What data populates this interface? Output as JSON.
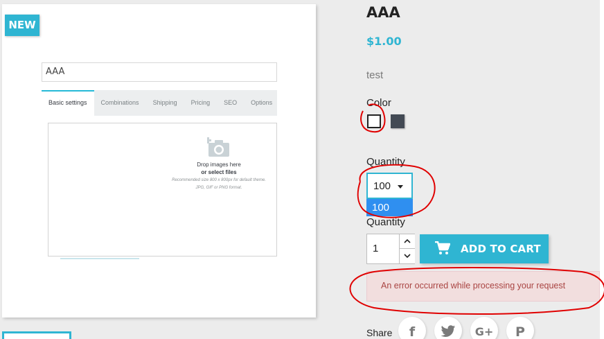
{
  "product_image": {
    "badge": "NEW",
    "inner_screenshot": {
      "name_field": "AAA",
      "tabs": [
        "Basic settings",
        "Combinations",
        "Shipping",
        "Pricing",
        "SEO",
        "Options"
      ],
      "drop_line1": "Drop images here",
      "drop_line2": "or select files",
      "drop_line3": "Recommended size 800 x 800px for default theme.",
      "drop_line4": "JPG, GIF or PNG format."
    }
  },
  "product": {
    "title": "AAA",
    "price": "$1.00",
    "description": "test"
  },
  "variants": {
    "color_label": "Color",
    "colors": [
      {
        "name": "white",
        "hex": "#ffffff",
        "selected": true
      },
      {
        "name": "dark-gray",
        "hex": "#434a54",
        "selected": false
      }
    ],
    "quantity_label": "Quantity",
    "quantity_selected": "100",
    "quantity_options": [
      "100"
    ]
  },
  "add_to_cart": {
    "quantity_label": "Quantity",
    "quantity_value": "1",
    "button_label": "ADD TO CART"
  },
  "error": {
    "message": "An error occurred while processing your request"
  },
  "share": {
    "label": "Share",
    "networks": [
      {
        "name": "facebook",
        "glyph": "f"
      },
      {
        "name": "twitter",
        "glyph": "t"
      },
      {
        "name": "google-plus",
        "glyph": "G+"
      },
      {
        "name": "pinterest",
        "glyph": "P"
      }
    ]
  },
  "colors": {
    "accent": "#2fb5d2",
    "error_bg": "#f2dede",
    "error_text": "#a94442",
    "annotation": "#e00000",
    "option_highlight": "#2f8ff0"
  }
}
